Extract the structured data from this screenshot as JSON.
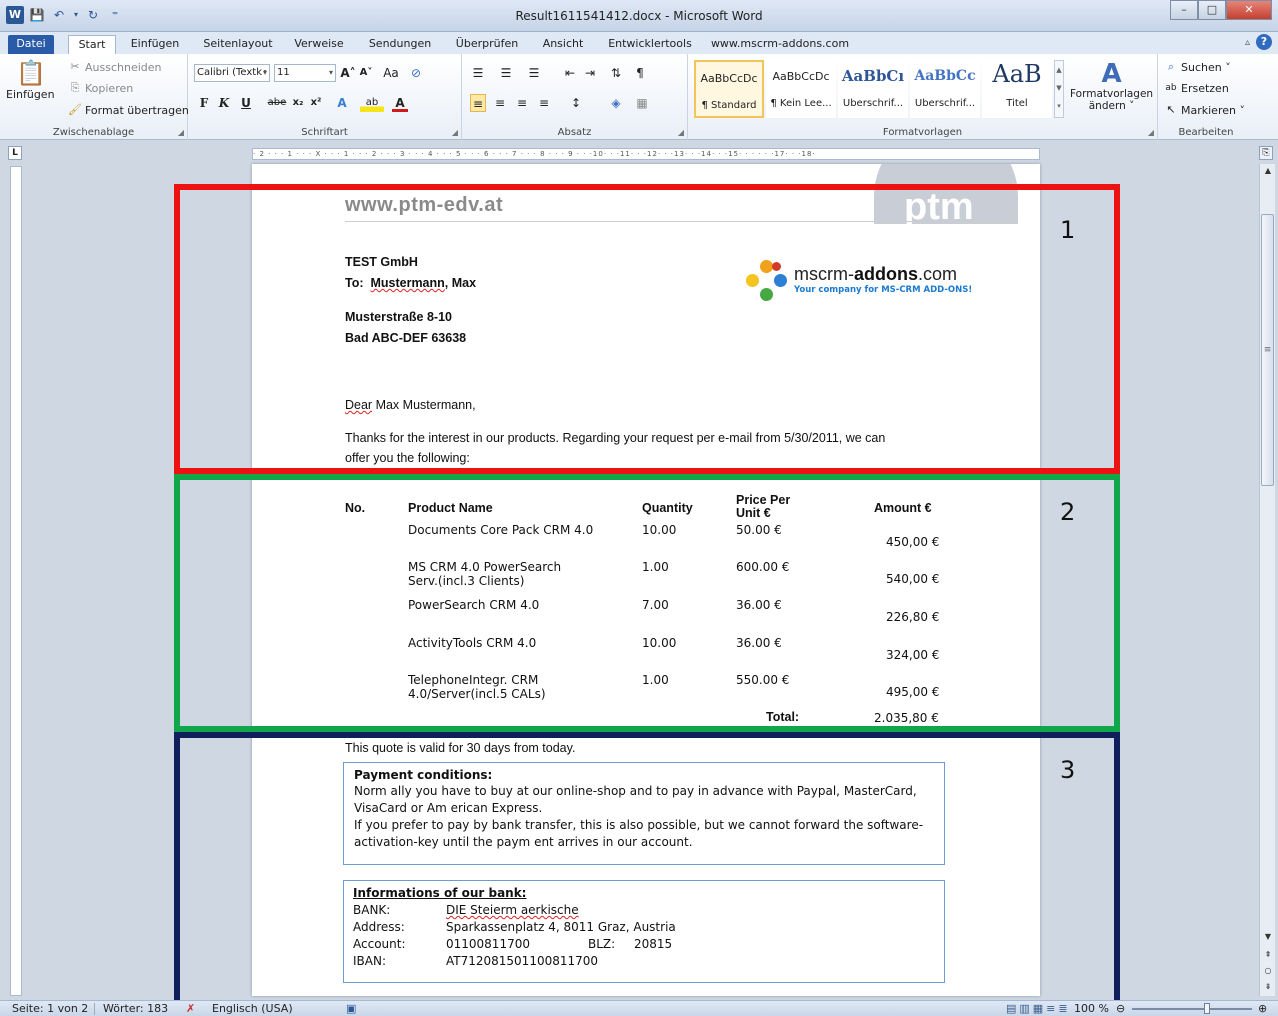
{
  "window": {
    "title": "Result1611541412.docx - Microsoft Word",
    "controls": {
      "minimize": "–",
      "maximize": "□",
      "close": "✕"
    }
  },
  "qat": {
    "logo": "W",
    "save": "💾",
    "undo": "↶",
    "undo_dd": "▾",
    "redo": "↻",
    "customize": "⁼"
  },
  "tabs": [
    "Datei",
    "Start",
    "Einfügen",
    "Seitenlayout",
    "Verweise",
    "Sendungen",
    "Überprüfen",
    "Ansicht",
    "Entwicklertools",
    "www.mscrm-addons.com"
  ],
  "help": {
    "collapse": "▵",
    "help": "?"
  },
  "ribbon": {
    "clipboard": {
      "label": "Zwischenablage",
      "paste": "Einfügen",
      "cut": "Ausschneiden",
      "copy": "Kopieren",
      "format_painter": "Format übertragen"
    },
    "font": {
      "label": "Schriftart",
      "font_name": "Calibri (Textk•",
      "font_size": "11",
      "bold": "F",
      "italic": "K",
      "underline": "U",
      "strike": "abe",
      "sub": "x₂",
      "sup": "x²",
      "grow": "A˄",
      "shrink": "A˅",
      "case": "Aa",
      "clear": "⊘"
    },
    "paragraph": {
      "label": "Absatz"
    },
    "styles": {
      "label": "Formatvorlagen",
      "items": [
        {
          "sample": "AaBbCcDc",
          "name": "¶ Standard"
        },
        {
          "sample": "AaBbCcDc",
          "name": "¶ Kein Lee..."
        },
        {
          "sample": "AaBbCı",
          "name": "Überschrif..."
        },
        {
          "sample": "AaBbCc",
          "name": "Überschrif..."
        },
        {
          "sample": "AaB",
          "name": "Titel"
        }
      ],
      "change_styles": "Formatvorlagen ändern",
      "change_styles_line1": "Formatvorlagen",
      "change_styles_line2": "ändern ˅"
    },
    "editing": {
      "label": "Bearbeiten",
      "find": "Suchen ˅",
      "replace": "Ersetzen",
      "select": "Markieren ˅"
    }
  },
  "ruler": {
    "corner": "L",
    "ticks": "· 2 · · · 1 · · · X · · · 1 · · · 2 · · · 3 · · · 4 · · · 5 · · · 6 · · · 7 · · · 8 · · · 9 · · ·10· · ·11· · ·12· · ·13· · ·14· · ·15· · · · · ·17· · ·18·"
  },
  "document": {
    "site_url": "www.ptm-edv.at",
    "ptm_logo": "ptm",
    "mscrm_logo": {
      "name_prefix": "mscrm-",
      "name_bold": "addons",
      "name_suffix": ".com",
      "tagline": "Your company for MS-CRM ADD-ONS!"
    },
    "company": "TEST GmbH",
    "to_label": "To:",
    "to_name": "Mustermann",
    "to_rest": ", Max",
    "street": "Musterstraße 8-10",
    "city": "Bad ABC-DEF 63638",
    "salutation_first": "Dear",
    "salutation_rest": " Max Mustermann,",
    "intro_line1": "Thanks for the interest in our products. Regarding your request per e-mail from 5/30/2011, we can",
    "intro_line2": "offer you the following:",
    "table": {
      "headers": {
        "no": "No.",
        "product": "Product Name",
        "quantity": "Quantity",
        "price_line1": "Price Per",
        "price_line2": "Unit €",
        "amount": "Amount €"
      },
      "rows": [
        {
          "product_l1": "Documents Core Pack CRM 4.0",
          "product_l2": "",
          "quantity": "10.00",
          "price": "50.00 €",
          "amount": "450,00 €"
        },
        {
          "product_l1": "MS CRM 4.0 PowerSearch",
          "product_l2": "Serv.(incl.3 Clients)",
          "quantity": "1.00",
          "price": "600.00 €",
          "amount": "540,00 €"
        },
        {
          "product_l1": "PowerSearch CRM 4.0",
          "product_l2": "",
          "quantity": "7.00",
          "price": "36.00 €",
          "amount": "226,80 €"
        },
        {
          "product_l1": "ActivityTools CRM 4.0",
          "product_l2": "",
          "quantity": "10.00",
          "price": "36.00 €",
          "amount": "324,00 €"
        },
        {
          "product_l1": "TelephoneIntegr. CRM",
          "product_l2": "4.0/Server(incl.5 CALs)",
          "quantity": "1.00",
          "price": "550.00 €",
          "amount": "495,00 €"
        }
      ],
      "total_label": "Total:",
      "total_value": "2.035,80 €"
    },
    "validity": "This quote is valid for 30  days from today.",
    "payment": {
      "title": "Payment conditions:",
      "line1": "Norm ally you have to buy at our online-shop and to pay in advance with Paypal, MasterCard,",
      "line2": "VisaCard or Am erican Express.",
      "line3": "If you prefer to pay by bank transfer, this is also possible, but we cannot forward the software-",
      "line4": "activation-key until the paym ent arrives in our account."
    },
    "bank": {
      "title": "Informations of our bank:",
      "bank_label": "BANK:",
      "bank_value": "DIE Steierm aerkische",
      "address_label": "Address:",
      "address_value": "Sparkassenplatz 4, 8011 Graz, Austria",
      "account_label": "Account:",
      "account_value": "01100811700",
      "blz_label": "BLZ:",
      "blz_value": "20815",
      "iban_label": "IBAN:",
      "iban_value": "AT712081501100811700"
    }
  },
  "annotations": [
    "1",
    "2",
    "3"
  ],
  "status": {
    "page": "Seite: 1 von 2",
    "words": "Wörter: 183",
    "language": "Englisch (USA)",
    "zoom": "100 %"
  },
  "colors": {
    "anno1": "#ee1111",
    "anno2": "#0fa74a",
    "anno3": "#0e1f5c",
    "file_tab": "#2a5ba8"
  }
}
